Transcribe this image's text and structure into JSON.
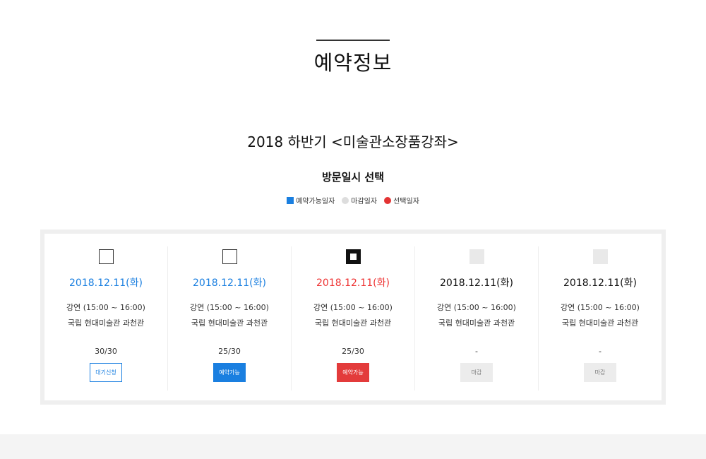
{
  "page": {
    "title": "예약정보"
  },
  "program": {
    "title": "2018 하반기 <미술관소장품강좌>"
  },
  "section": {
    "title": "방문일시 선택"
  },
  "legend": [
    {
      "label": "예약가능일자",
      "color": "#1a7fe0",
      "shape": "square"
    },
    {
      "label": "마감일자",
      "color": "#dddddd",
      "shape": "dot"
    },
    {
      "label": "선택일자",
      "color": "#e33333",
      "shape": "dot"
    }
  ],
  "days": [
    {
      "date": "2018.12.11(화)",
      "session": "강연 (15:00 ~ 16:00)",
      "venue": "국립 현대미술관 과천관",
      "count": "30/30",
      "button": "대기신청",
      "state": "waitlist"
    },
    {
      "date": "2018.12.11(화)",
      "session": "강연 (15:00 ~ 16:00)",
      "venue": "국립 현대미술관 과천관",
      "count": "25/30",
      "button": "예약가능",
      "state": "available"
    },
    {
      "date": "2018.12.11(화)",
      "session": "강연 (15:00 ~ 16:00)",
      "venue": "국립 현대미술관 과천관",
      "count": "25/30",
      "button": "예약가능",
      "state": "selected"
    },
    {
      "date": "2018.12.11(화)",
      "session": "강연 (15:00 ~ 16:00)",
      "venue": "국립 현대미술관 과천관",
      "count": "-",
      "button": "마감",
      "state": "closed"
    },
    {
      "date": "2018.12.11(화)",
      "session": "강연 (15:00 ~ 16:00)",
      "venue": "국립 현대미술관 과천관",
      "count": "-",
      "button": "마감",
      "state": "closed"
    }
  ]
}
